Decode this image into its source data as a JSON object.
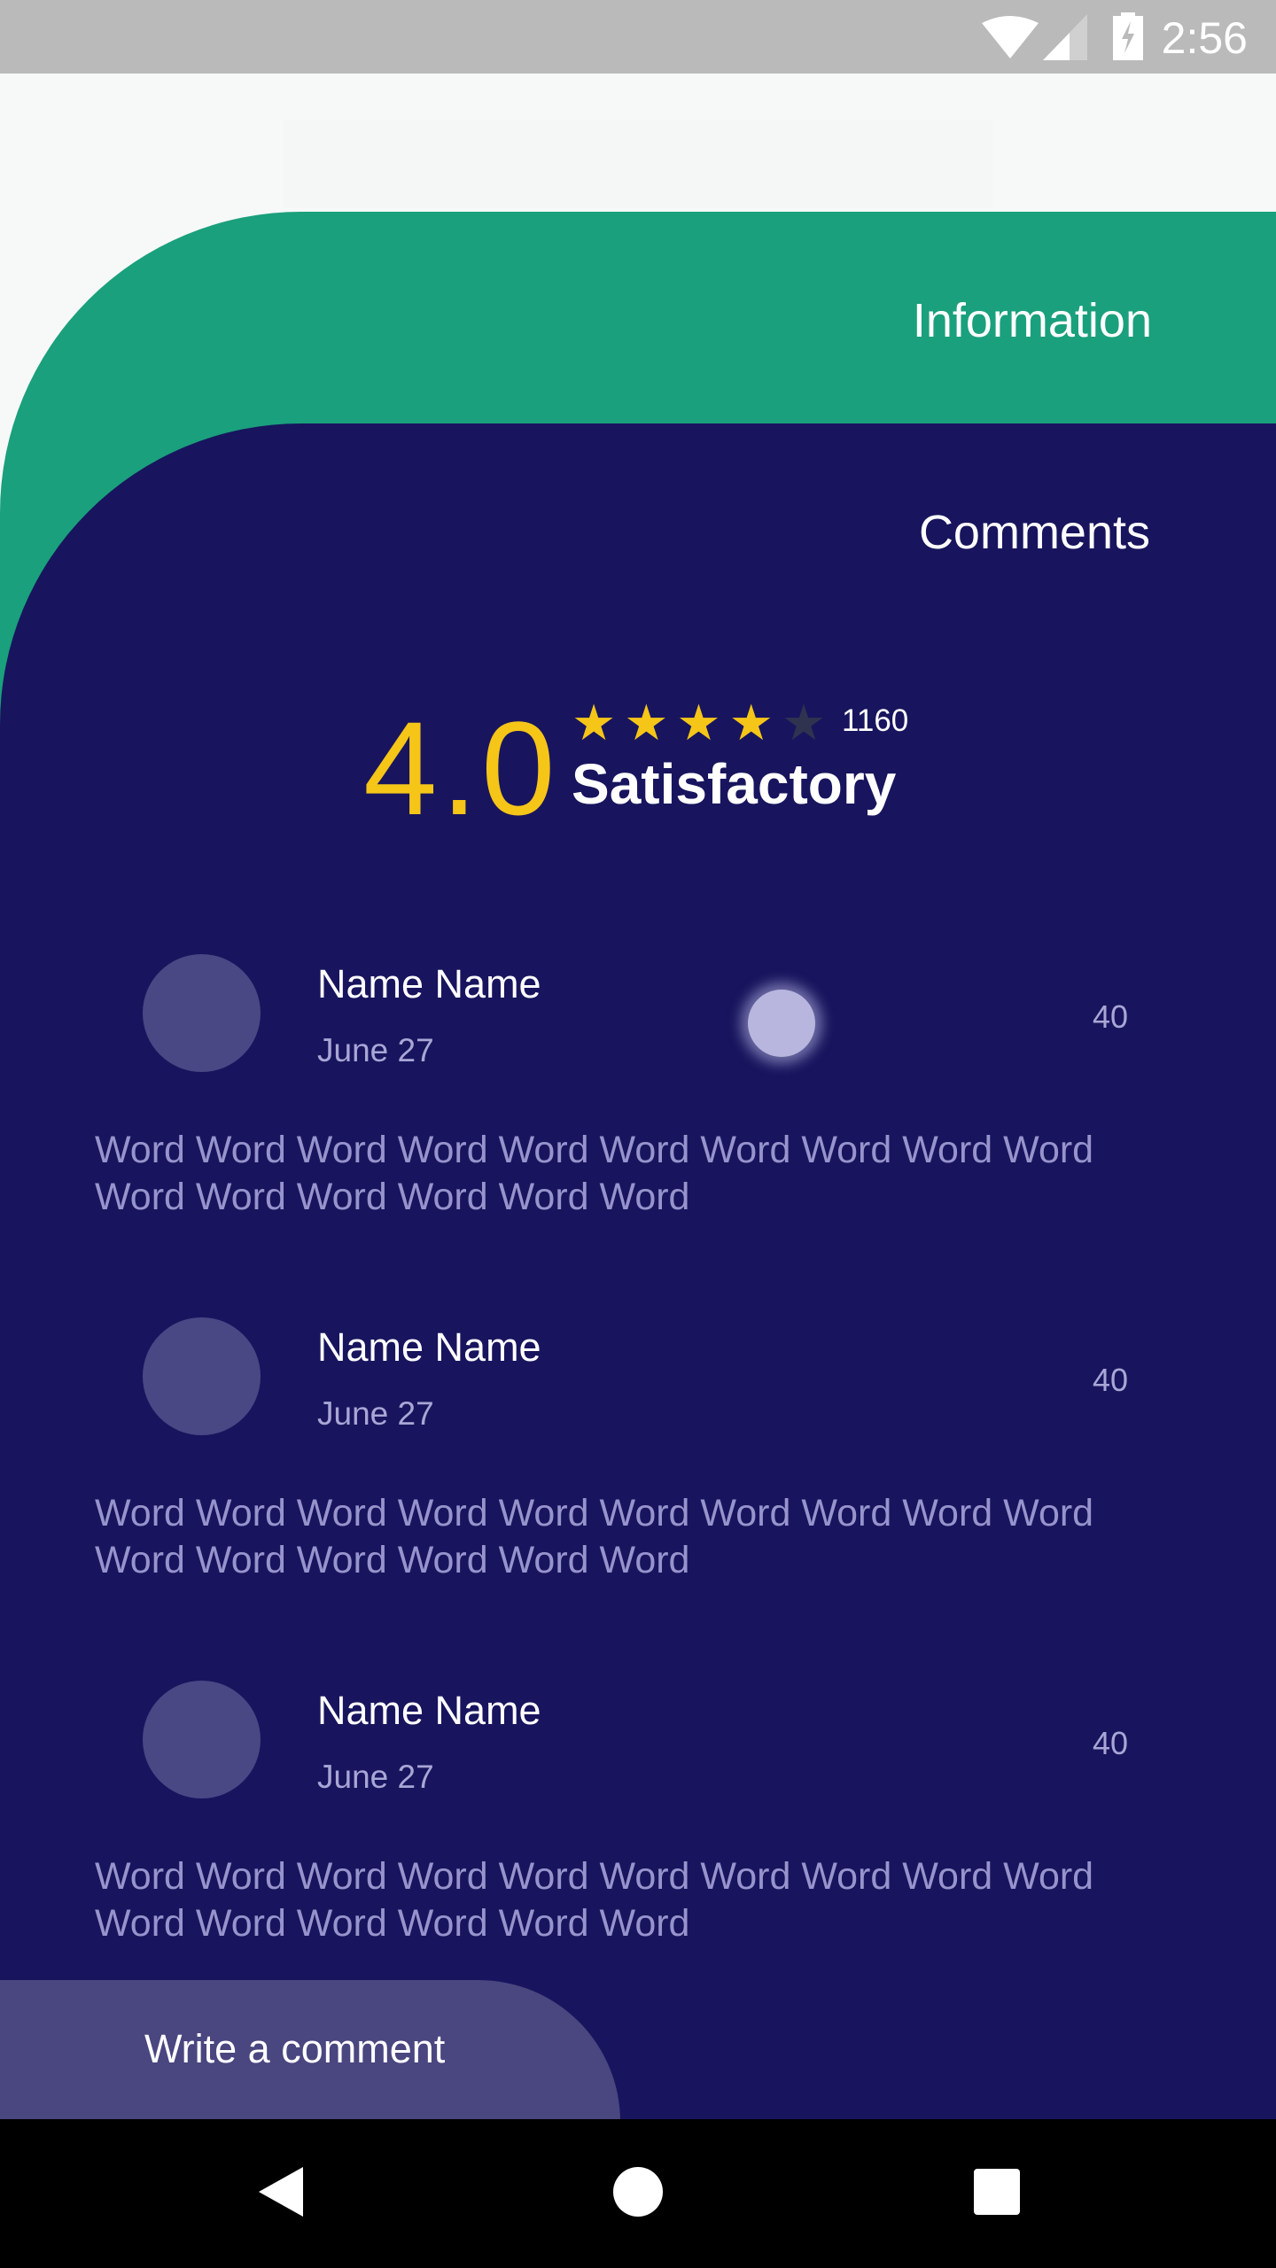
{
  "status_bar": {
    "time": "2:56",
    "icons": [
      "wifi-icon",
      "signal-icon",
      "battery-charging-icon"
    ]
  },
  "tabs": {
    "information": "Information",
    "comments": "Comments"
  },
  "rating": {
    "score": "4.0",
    "stars_filled": 4,
    "stars_total": 5,
    "count": "1160",
    "verdict": "Satisfactory"
  },
  "comments": [
    {
      "name": "Name Name",
      "date": "June 27",
      "likes": "40",
      "text": "Word Word Word Word Word Word Word Word Word Word Word Word Word Word Word Word"
    },
    {
      "name": "Name Name",
      "date": "June 27",
      "likes": "40",
      "text": "Word Word Word Word Word Word Word Word Word Word Word Word Word Word Word Word"
    },
    {
      "name": "Name Name",
      "date": "June 27",
      "likes": "40",
      "text": "Word Word Word Word Word Word Word Word Word Word Word Word Word Word Word Word"
    }
  ],
  "write_button": "Write a comment",
  "colors": {
    "green": "#1aa07c",
    "navy": "#18155e",
    "accent": "#f5c518",
    "avatar": "#4a4785"
  }
}
